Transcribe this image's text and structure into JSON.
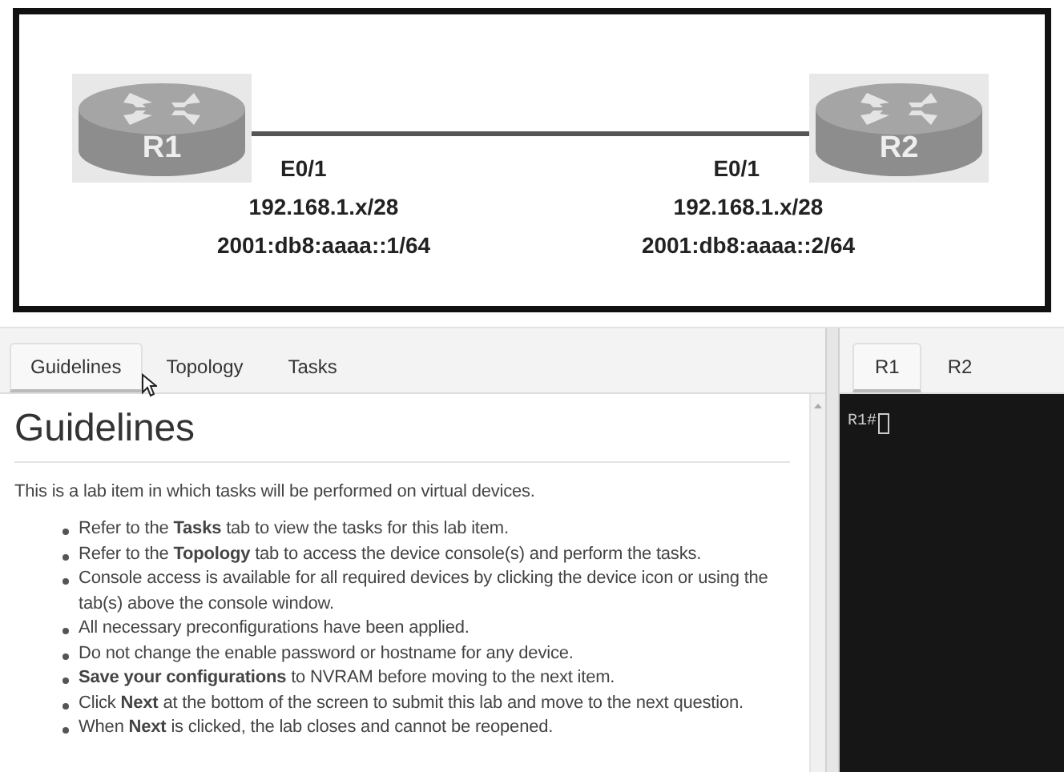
{
  "topology": {
    "devices": [
      {
        "name": "R1"
      },
      {
        "name": "R2"
      }
    ],
    "link_ends": [
      {
        "interface": "E0/1",
        "ipv4": "192.168.1.x/28",
        "ipv6": "2001:db8:aaaa::1/64"
      },
      {
        "interface": "E0/1",
        "ipv4": "192.168.1.x/28",
        "ipv6": "2001:db8:aaaa::2/64"
      }
    ]
  },
  "tabs": [
    {
      "label": "Guidelines",
      "selected": true
    },
    {
      "label": "Topology",
      "selected": false
    },
    {
      "label": "Tasks",
      "selected": false
    }
  ],
  "guidelines": {
    "heading": "Guidelines",
    "intro": "This is a lab item in which tasks will be performed on virtual devices.",
    "items": [
      "Refer to the **Tasks** tab to view the tasks for this lab item.",
      "Refer to the **Topology** tab to access the device console(s) and perform the tasks.",
      "Console access is available for all required devices by clicking the device icon or using the tab(s) above the console window.",
      "All necessary preconfigurations have been applied.",
      "Do not change the enable password or hostname for any device.",
      "**Save your configurations** to NVRAM before moving to the next item.",
      "Click **Next** at the bottom of the screen to submit this lab and move to the next question.",
      "When **Next** is clicked, the lab closes and cannot be reopened."
    ]
  },
  "console": {
    "tabs": [
      {
        "label": "R1",
        "selected": true
      },
      {
        "label": "R2",
        "selected": false
      }
    ],
    "prompt": "R1#"
  }
}
